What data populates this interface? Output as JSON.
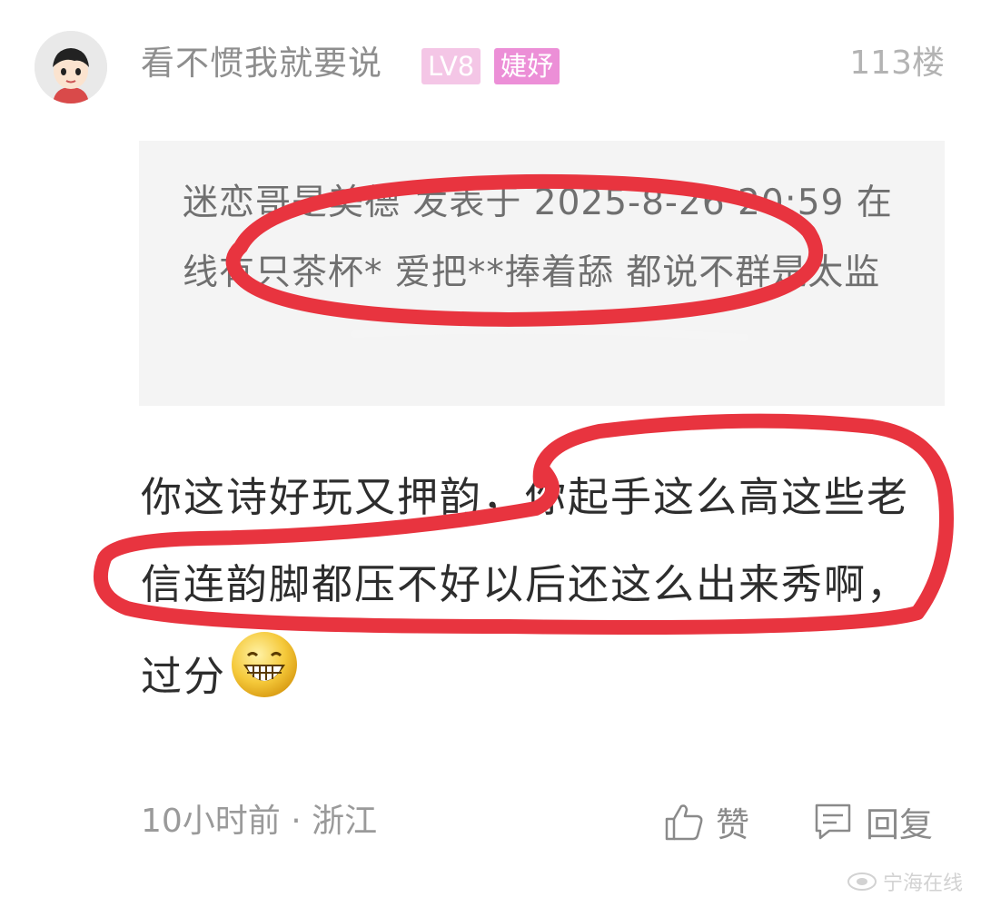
{
  "post": {
    "username": "看不惯我就要说",
    "level_badge": "LV8",
    "tag_badge": "婕妤",
    "floor": "113楼",
    "quote": "迷恋哥是美德 发表于 2025-8-26 20:59 在线有只茶杯* 爱把**捧着舔 都说不群是太监",
    "reply": "你这诗好玩又押韵，你起手这么高这些老信连韵脚都压不好以后还这么出来秀啊，过分",
    "time_location": "10小时前 · 浙江",
    "like_label": "赞",
    "reply_label": "回复"
  },
  "watermark": "宁海在线",
  "colors": {
    "level_badge": "#f4c6e6",
    "tag_badge": "#ec8fd7",
    "quote_bg": "#f4f4f4",
    "annotation_red": "#e8343f"
  },
  "icons": {
    "avatar": "cartoon-face-avatar",
    "emoji": "grinning-face-emoji",
    "like": "thumbs-up-icon",
    "reply": "comment-bubble-icon"
  }
}
